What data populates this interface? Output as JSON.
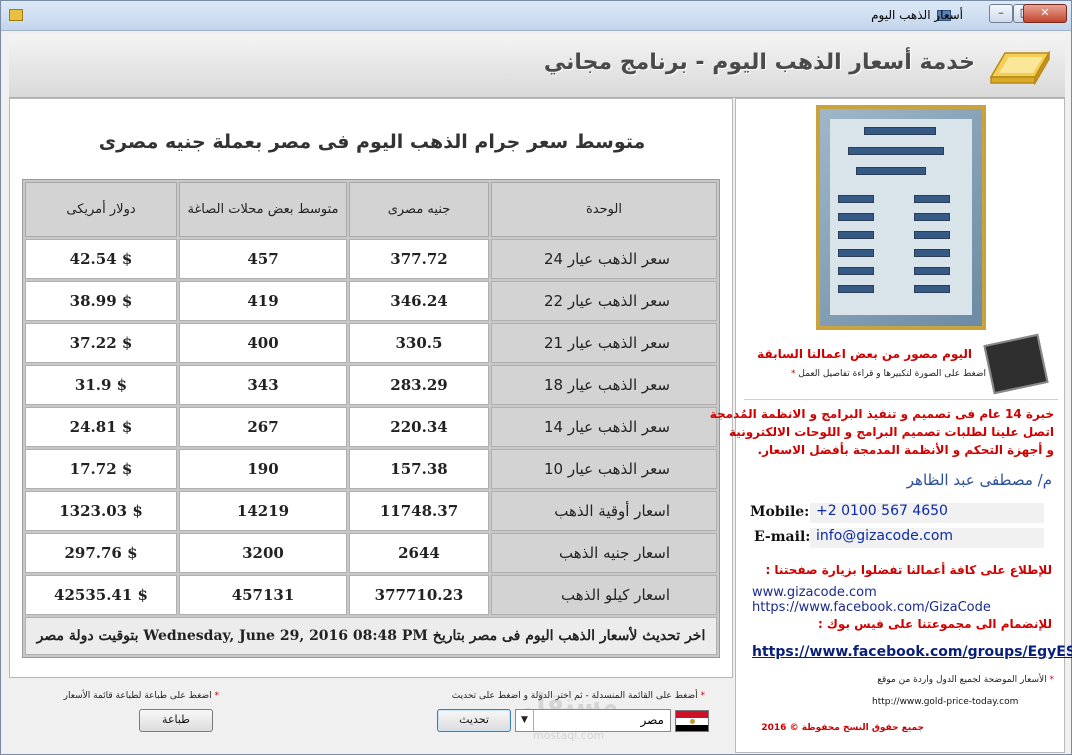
{
  "window": {
    "title": "أسعار الذهب اليوم",
    "close_label": "✕",
    "min_label": "–",
    "max_label": "□"
  },
  "header": {
    "title": "خدمة أسعار الذهب اليوم - برنامج مجاني"
  },
  "main": {
    "heading": "متوسط سعر جرام الذهب اليوم فى مصر بعملة جنيه مصرى",
    "columns": [
      "الوحدة",
      "جنيه مصرى",
      "متوسط بعض محلات الصاغة",
      "دولار أمريكى"
    ],
    "rows": [
      {
        "unit": "سعر الذهب عيار 24",
        "egp": "377.72",
        "shops": "457",
        "usd": "$ 42.54"
      },
      {
        "unit": "سعر الذهب عيار 22",
        "egp": "346.24",
        "shops": "419",
        "usd": "$ 38.99"
      },
      {
        "unit": "سعر الذهب عيار 21",
        "egp": "330.5",
        "shops": "400",
        "usd": "$ 37.22"
      },
      {
        "unit": "سعر الذهب عيار 18",
        "egp": "283.29",
        "shops": "343",
        "usd": "$ 31.9"
      },
      {
        "unit": "سعر الذهب عيار 14",
        "egp": "220.34",
        "shops": "267",
        "usd": "$ 24.81"
      },
      {
        "unit": "سعر الذهب عيار 10",
        "egp": "157.38",
        "shops": "190",
        "usd": "$ 17.72"
      },
      {
        "unit": "اسعار أوقية الذهب",
        "egp": "11748.37",
        "shops": "14219",
        "usd": "$ 1323.03"
      },
      {
        "unit": "اسعار جنيه الذهب",
        "egp": "2644",
        "shops": "3200",
        "usd": "$ 297.76"
      },
      {
        "unit": "اسعار كيلو الذهب",
        "egp": "377710.23",
        "shops": "457131",
        "usd": "$ 42535.41"
      }
    ],
    "footer": "اخر تحديث لأسعار الذهب اليوم فى مصر بتاريخ Wednesday, June 29, 2016 08:48 PM بتوقيت دولة مصر"
  },
  "controls": {
    "update_note": "أضغط على القائمة المنسدلة - ثم اختر الدولة و اضغط على تحديث",
    "print_note": "اضغط على طباعة لطباعة قائمة الأسعار",
    "update_label": "تحديث",
    "print_label": "طباعة",
    "country_selected": "مصر",
    "watermark": "مستقل",
    "watermark_sub": "mostaql.com"
  },
  "side": {
    "photo_caption": "اليوم مصور من بعض اعمالنا السابقة",
    "photo_hint": "اضغط على الصورة لتكبيرها و قراءة تفاصيل العمل",
    "experience_lines": [
      "خبرة 14 عام فى تصميم و تنفيذ البرامج و الانظمة المُدمجة",
      "اتصل علينا لطلبات تصميم البرامج و اللوحات الالكترونية",
      "و أجهزة التحكم و الأنظمة المدمجة بأفضل الاسعار."
    ],
    "engineer": "م/ مصطفى عبد الظاهر",
    "mobile_label": "Mobile:",
    "mobile_value": "+2 0100 567 4650",
    "email_label": "E-mail:",
    "email_value": "info@gizacode.com",
    "visit_text": "للإطلاع على كافة أعمالنا تفضلوا بزيارة صفحتنا :",
    "site_link": "www.gizacode.com",
    "fb_page_link": "https://www.facebook.com/GizaCode",
    "join_text": "للإنضمام الى مجموعتنا على فيس بوك :",
    "fb_group_link": "https://www.facebook.com/groups/EgyESD",
    "source_note": "الأسعار الموضحة لجميع الدول واردة من موقع",
    "source_link": "http://www.gold-price-today.com",
    "copyright": "جميع حقوق النسخ محفوظة © 2016"
  },
  "colors": {
    "accent_red": "#d00000",
    "link_blue": "#1a2a8a",
    "header_gray": "#d3d3d3"
  }
}
